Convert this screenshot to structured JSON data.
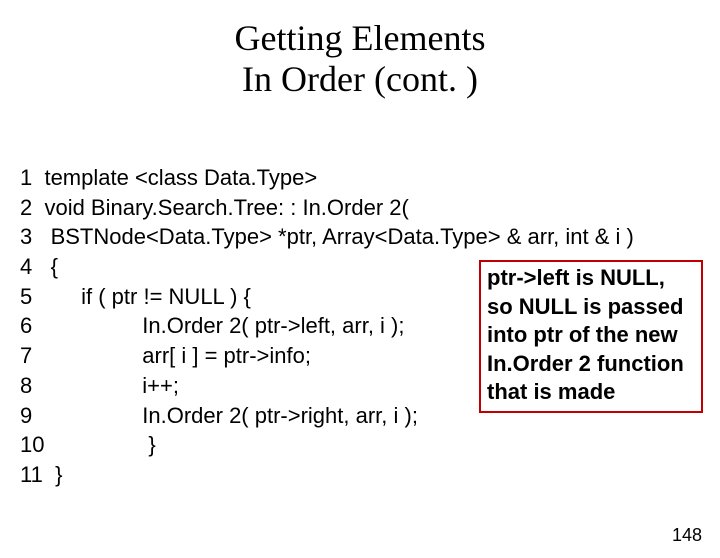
{
  "title": {
    "line1": "Getting Elements",
    "line2": "In Order (cont. )"
  },
  "code": {
    "l1": "1  template <class Data.Type>",
    "l2": "2  void Binary.Search.Tree: : In.Order 2(",
    "l3": "3   BSTNode<Data.Type> *ptr, Array<Data.Type> & arr, int & i )",
    "l4": "4   {",
    "l5": "5        if ( ptr != NULL ) {",
    "l6": "6                  In.Order 2( ptr->left, arr, i );",
    "l7": "7                  arr[ i ] = ptr->info;",
    "l8": "8                  i++;",
    "l9": "9                  In.Order 2( ptr->right, arr, i );",
    "l10": "10                 }",
    "l11": "11  }"
  },
  "note": "ptr->left is NULL, so NULL is passed into ptr of the new In.Order 2 function that is made",
  "pagenum": "148"
}
